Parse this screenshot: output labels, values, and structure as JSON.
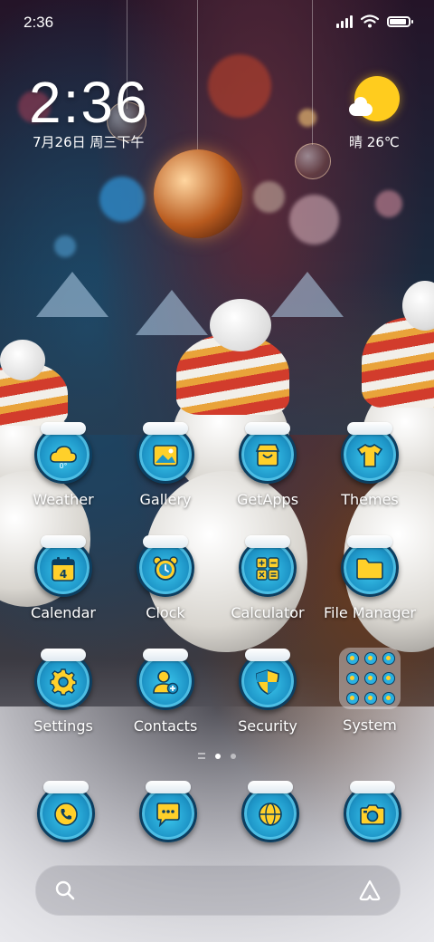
{
  "status_bar": {
    "time": "2:36",
    "battery_level": 0.88
  },
  "clock_widget": {
    "time": "2:36",
    "date": "7月26日 周三下午"
  },
  "weather_widget": {
    "condition": "晴",
    "temperature": "26℃"
  },
  "apps": [
    {
      "label": "Weather"
    },
    {
      "label": "Gallery"
    },
    {
      "label": "GetApps"
    },
    {
      "label": "Themes"
    },
    {
      "label": "Calendar"
    },
    {
      "label": "Clock"
    },
    {
      "label": "Calculator"
    },
    {
      "label": "File Manager"
    },
    {
      "label": "Settings"
    },
    {
      "label": "Contacts"
    },
    {
      "label": "Security"
    },
    {
      "label": "System"
    }
  ],
  "weather_icon_badge": "0°",
  "calendar_icon_day": "4",
  "page_indicator": {
    "pages": 2,
    "current": 1
  },
  "dock": [
    "phone-icon",
    "messages-icon",
    "browser-icon",
    "camera-icon"
  ],
  "colors": {
    "icon_accent": "#ffd02a",
    "icon_base": "#1e96c8"
  }
}
